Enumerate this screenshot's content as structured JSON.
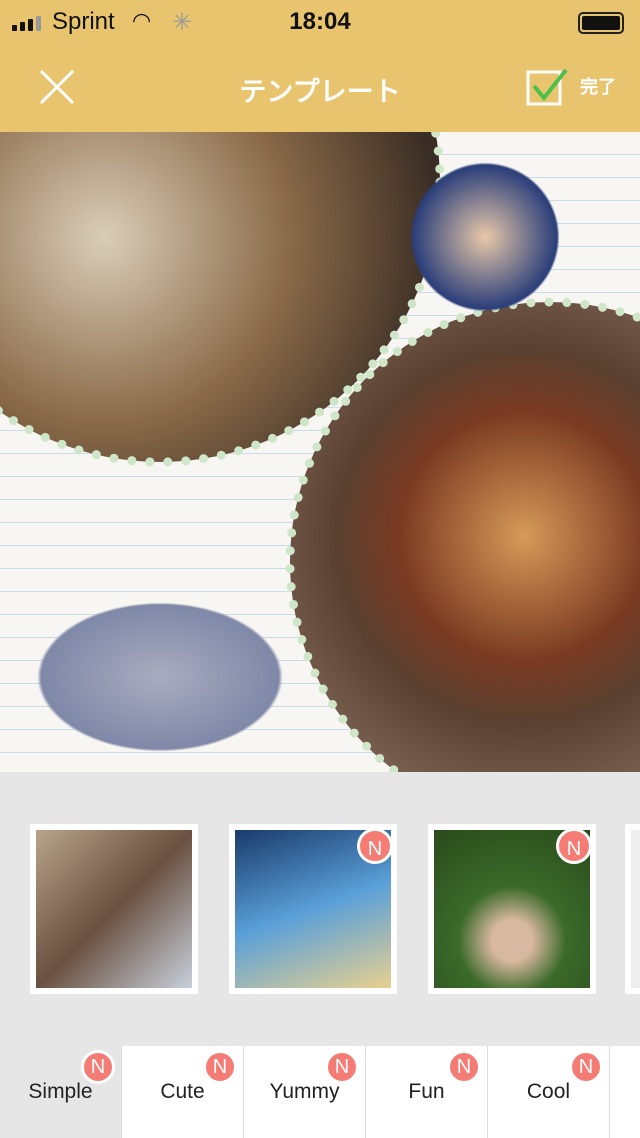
{
  "status_bar": {
    "carrier": "Sprint",
    "time": "18:04"
  },
  "header": {
    "title": "テンプレート",
    "done_label": "完了"
  },
  "colors": {
    "header": "#e8c46e",
    "badge": "#f47c74",
    "check": "#4cc04a"
  },
  "thumbnails": [
    {
      "name": "simple-collage",
      "new": false
    },
    {
      "name": "summer",
      "new": true,
      "badge": "N"
    },
    {
      "name": "bird-portrait",
      "new": true,
      "badge": "N"
    }
  ],
  "tabs": [
    {
      "label": "Simple",
      "badge": "N",
      "selected": true
    },
    {
      "label": "Cute",
      "badge": "N"
    },
    {
      "label": "Yummy",
      "badge": "N"
    },
    {
      "label": "Fun",
      "badge": "N"
    },
    {
      "label": "Cool",
      "badge": "N"
    }
  ]
}
